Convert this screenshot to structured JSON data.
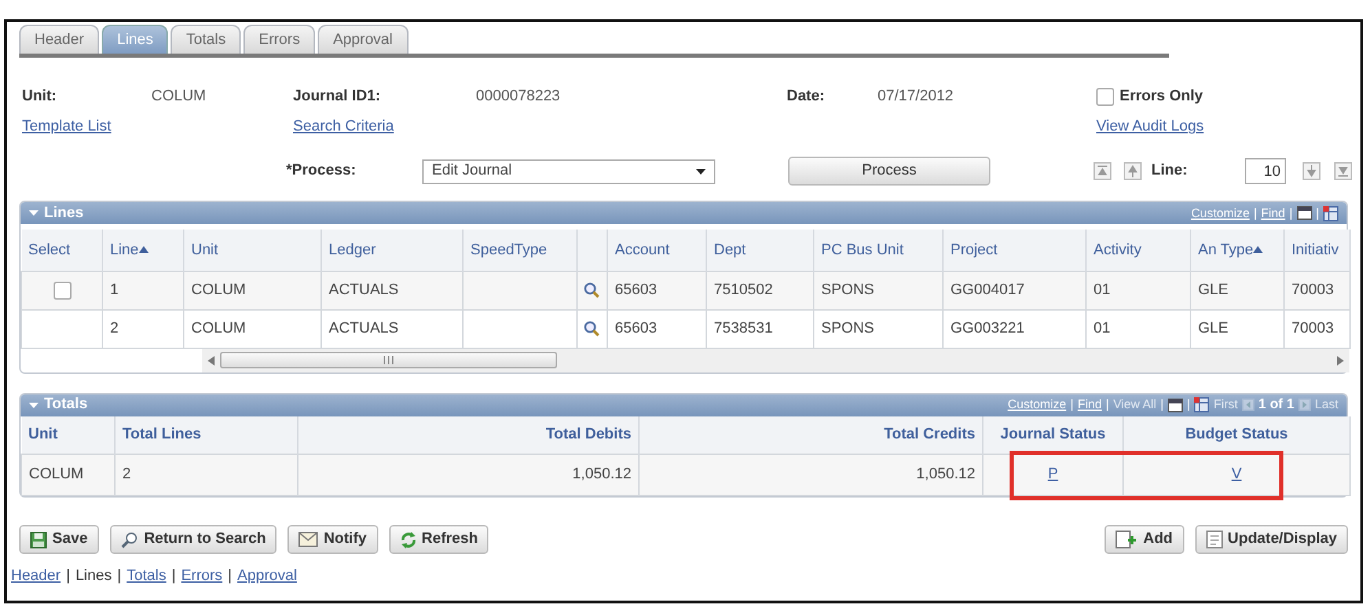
{
  "tabs": [
    {
      "label": "Header",
      "selected": false
    },
    {
      "label": "Lines",
      "selected": true
    },
    {
      "label": "Totals",
      "selected": false
    },
    {
      "label": "Errors",
      "selected": false
    },
    {
      "label": "Approval",
      "selected": false
    }
  ],
  "header": {
    "fields": [
      {
        "label": "Unit:",
        "value": "COLUM"
      },
      {
        "label": "Journal ID1:",
        "value": "0000078223"
      },
      {
        "label": "Date:",
        "value": "07/17/2012"
      }
    ],
    "errors_only": {
      "label": "Errors Only",
      "checked": false
    },
    "links": [
      "Template List",
      "Search Criteria",
      "View Audit Logs"
    ],
    "process": {
      "label": "*Process:",
      "value": "Edit Journal",
      "button": "Process"
    },
    "line_nav": {
      "label": "Line:",
      "value": "10"
    }
  },
  "lines_grid": {
    "title": "Lines",
    "toolbar": [
      {
        "kind": "link",
        "text": "Customize"
      },
      {
        "kind": "sep",
        "text": "|"
      },
      {
        "kind": "link",
        "text": "Find"
      },
      {
        "kind": "sep",
        "text": "|"
      },
      {
        "kind": "view"
      },
      {
        "kind": "sep",
        "text": "|"
      },
      {
        "kind": "export"
      }
    ],
    "columns": [
      {
        "kind": "select",
        "label": "Select"
      },
      {
        "kind": "text",
        "label": "Line",
        "sorted": true
      },
      {
        "kind": "text",
        "label": "Unit",
        "sorted": false
      },
      {
        "kind": "text",
        "label": "Ledger",
        "sorted": false
      },
      {
        "kind": "text",
        "label": "SpeedType",
        "sorted": false
      },
      {
        "kind": "lookup"
      },
      {
        "kind": "text",
        "label": "Account",
        "sorted": false
      },
      {
        "kind": "text",
        "label": "Dept",
        "sorted": false
      },
      {
        "kind": "text",
        "label": "PC Bus Unit",
        "sorted": false
      },
      {
        "kind": "text",
        "label": "Project",
        "sorted": false
      },
      {
        "kind": "text",
        "label": "Activity",
        "sorted": false
      },
      {
        "kind": "text",
        "label": "An Type",
        "sorted": true
      },
      {
        "kind": "text",
        "label": "Initiativ",
        "sorted": false
      }
    ],
    "rows": [
      {
        "checked": false,
        "cells": [
          "",
          "1",
          "COLUM",
          "ACTUALS",
          "",
          "",
          "65603",
          "7510502",
          "SPONS",
          "GG004017",
          "01",
          "GLE",
          "70003"
        ]
      },
      {
        "cells": [
          "",
          "2",
          "COLUM",
          "ACTUALS",
          "",
          "",
          "65603",
          "7538531",
          "SPONS",
          "GG003221",
          "01",
          "GLE",
          "70003"
        ]
      }
    ]
  },
  "totals_grid": {
    "title": "Totals",
    "toolbar": [
      {
        "kind": "link",
        "text": "Customize"
      },
      {
        "kind": "sep",
        "text": "|"
      },
      {
        "kind": "link",
        "text": "Find"
      },
      {
        "kind": "sep",
        "text": "|"
      },
      {
        "kind": "link",
        "text": "View All",
        "disabled": true
      },
      {
        "kind": "sep",
        "text": "|"
      },
      {
        "kind": "view"
      },
      {
        "kind": "sep",
        "text": "|"
      },
      {
        "kind": "export"
      },
      {
        "kind": "link",
        "text": "First",
        "disabled": true
      },
      {
        "kind": "prev",
        "disabled": true
      },
      {
        "kind": "text",
        "text": "1 of 1"
      },
      {
        "kind": "next",
        "disabled": true
      },
      {
        "kind": "link",
        "text": "Last",
        "disabled": true
      }
    ],
    "columns": [
      {
        "kind": "text",
        "label": "Unit",
        "highlighted": false
      },
      {
        "kind": "text",
        "label": "Total Lines",
        "highlighted": false
      },
      {
        "kind": "amount",
        "label": "Total Debits",
        "highlighted": false
      },
      {
        "kind": "amount",
        "label": "Total Credits",
        "highlighted": false
      },
      {
        "kind": "status",
        "label": "Journal Status",
        "highlighted": true
      },
      {
        "kind": "status",
        "label": "Budget Status",
        "highlighted": true
      }
    ],
    "rows": [
      {
        "cells": [
          "COLUM",
          "2",
          "1,050.12",
          "1,050.12",
          "P",
          "V"
        ]
      }
    ]
  },
  "buttons_left": [
    {
      "kind": "save",
      "label": "Save"
    },
    {
      "kind": "search",
      "label": "Return to Search"
    },
    {
      "kind": "notify",
      "label": "Notify"
    },
    {
      "kind": "refresh",
      "label": "Refresh"
    }
  ],
  "buttons_right": [
    {
      "kind": "add",
      "label": "Add"
    },
    {
      "kind": "update",
      "label": "Update/Display"
    }
  ],
  "footer_nav": [
    {
      "kind": "link",
      "text": "Header"
    },
    {
      "kind": "sep",
      "text": "|"
    },
    {
      "kind": "current",
      "text": "Lines"
    },
    {
      "kind": "sep",
      "text": "|"
    },
    {
      "kind": "link",
      "text": "Totals"
    },
    {
      "kind": "sep",
      "text": "|"
    },
    {
      "kind": "link",
      "text": "Errors"
    },
    {
      "kind": "sep",
      "text": "|"
    },
    {
      "kind": "link",
      "text": "Approval"
    }
  ]
}
